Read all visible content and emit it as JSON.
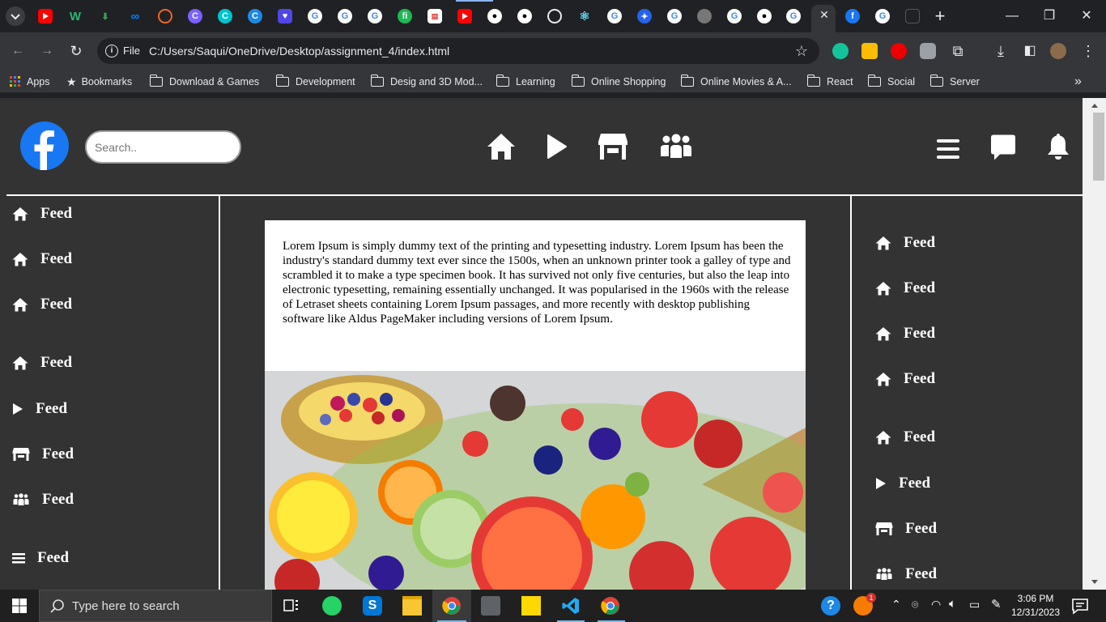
{
  "browser": {
    "tab_close_glyph": "✕",
    "new_tab_glyph": "+",
    "window_controls": {
      "minimize": "—",
      "restore": "❐",
      "close": "✕"
    },
    "omnibox": {
      "scheme_label": "File",
      "url": "C:/Users/Saqui/OneDrive/Desktop/assignment_4/index.html"
    },
    "bookmarks": [
      {
        "label": "Apps",
        "icon": "apps-grid-icon"
      },
      {
        "label": "Bookmarks",
        "icon": "star-icon"
      },
      {
        "label": "Download &  Games",
        "icon": "folder-icon"
      },
      {
        "label": "Development",
        "icon": "folder-icon"
      },
      {
        "label": "Desig and 3D Mod...",
        "icon": "folder-icon"
      },
      {
        "label": "Learning",
        "icon": "folder-icon"
      },
      {
        "label": "Online Shopping",
        "icon": "folder-icon"
      },
      {
        "label": "Online Movies & A...",
        "icon": "folder-icon"
      },
      {
        "label": "React",
        "icon": "folder-icon"
      },
      {
        "label": "Social",
        "icon": "folder-icon"
      },
      {
        "label": "Server",
        "icon": "folder-icon"
      }
    ],
    "bookmarks_overflow_glyph": "»"
  },
  "page": {
    "search_placeholder": "Search..",
    "left_sidebar": [
      {
        "label": "Feed",
        "icon": "home-icon"
      },
      {
        "label": "Feed",
        "icon": "home-icon"
      },
      {
        "label": "Feed",
        "icon": "home-icon"
      },
      {
        "label": "Feed",
        "icon": "home-icon"
      },
      {
        "label": "Feed",
        "icon": "play-icon"
      },
      {
        "label": "Feed",
        "icon": "store-icon"
      },
      {
        "label": "Feed",
        "icon": "group-icon"
      },
      {
        "label": "Feed",
        "icon": "menu-icon"
      }
    ],
    "right_sidebar": [
      {
        "label": "Feed",
        "icon": "home-icon"
      },
      {
        "label": "Feed",
        "icon": "home-icon"
      },
      {
        "label": "Feed",
        "icon": "home-icon"
      },
      {
        "label": "Feed",
        "icon": "home-icon"
      },
      {
        "label": "Feed",
        "icon": "home-icon"
      },
      {
        "label": "Feed",
        "icon": "play-icon"
      },
      {
        "label": "Feed",
        "icon": "store-icon"
      },
      {
        "label": "Feed",
        "icon": "group-icon"
      }
    ],
    "post_text": "Lorem Ipsum is simply dummy text of the printing and typesetting industry. Lorem Ipsum has been the industry's standard dummy text ever since the 1500s, when an unknown printer took a galley of type and scrambled it to make a type specimen book. It has survived not only five centuries, but also the leap into electronic typesetting, remaining essentially unchanged. It was popularised in the 1960s with the release of Letraset sheets containing Lorem Ipsum passages, and more recently with desktop publishing software like Aldus PageMaker including versions of Lorem Ipsum.",
    "colors": {
      "background": "#333333",
      "facebook_blue": "#1877f2"
    }
  },
  "taskbar": {
    "search_placeholder": "Type here to search",
    "clock_time": "3:06 PM",
    "clock_date": "12/31/2023",
    "notification_badge": "1"
  }
}
